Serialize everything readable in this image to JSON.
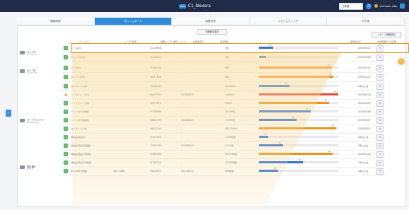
{
  "header": {
    "badge": "IIIIII",
    "title": "C1_Nexera",
    "language": "日本語",
    "help_icon": "?",
    "user": "shimadzu labo"
  },
  "tabs": [
    {
      "label": "機器稼働",
      "active": false
    },
    {
      "label": "ダッシュボード",
      "active": true
    },
    {
      "label": "装置状態",
      "active": false
    },
    {
      "label": "システムチェック",
      "active": false
    },
    {
      "label": "その他",
      "active": false
    }
  ],
  "toolbar": {
    "top_button": "全機器を表示",
    "right_button": "レポート機能追加"
  },
  "columns": {
    "col1": "ステータス",
    "col2": "シリアル番号",
    "col3": "機器シリアル番号 シリーズ",
    "col4": "最終使用日",
    "col5": "使用時間",
    "col6": "前回交換日",
    "col7": "交換予定日",
    "col8": "交換時期までの日数"
  },
  "groups": [
    {
      "name": "ポンプA",
      "sub": "LC-40D XR",
      "icon": "pump-icon"
    },
    {
      "name": "ポンプB",
      "sub": "LC-40D XR",
      "icon": "pump-icon"
    },
    {
      "name": "オートサンプラー",
      "sub": "SIL-40C XR",
      "icon": "autosampler-icon"
    },
    {
      "name": "検出器A",
      "sub": "SPD-40",
      "icon": "detector-icon"
    }
  ],
  "rows": [
    {
      "status": "ok",
      "name": "シール(A)",
      "serial": "",
      "code": "10130506",
      "last": "-",
      "hours": "5回",
      "pct": 0.18,
      "bar_color": "#2f6fd6",
      "bar_label": "18",
      "date": "2019/03/15"
    },
    {
      "status": "ok",
      "name": "チェック弁(A)",
      "serial": "",
      "code": "1219A6C0",
      "last": "-",
      "hours": "5回",
      "pct": 0.09,
      "bar_color": "#2f6fd6",
      "bar_label": "9",
      "date": "2019/05/18"
    },
    {
      "status": "ok",
      "name": "シール(B)",
      "serial": "",
      "code": "3A7B4340",
      "last": "-",
      "hours": "8回",
      "pct": 0.92,
      "bar_color": "#e8931c",
      "bar_label": "92",
      "date": "2019/01/31"
    },
    {
      "status": "ok",
      "name": "チェック弁(B)",
      "serial": "",
      "code": "3B5F1B90",
      "last": "-",
      "hours": "8回",
      "pct": 0.94,
      "bar_color": "#e8931c",
      "bar_label": "94",
      "date": "2019/02/27"
    },
    {
      "status": "ok",
      "name": "ロータシール(A)",
      "serial": "",
      "code": "7D4A57B0",
      "last": "-",
      "hours": "35,818mL",
      "pct": 0.38,
      "bar_color": "#2f6fd6",
      "bar_label": "38",
      "date": "1年以上先"
    },
    {
      "status": "warn",
      "name": "ニードルシール(A)",
      "serial": "",
      "code": "8A47F7D0",
      "last": "2018/08/23",
      "hours": "1,234mL",
      "pct": 1.0,
      "bar_color": "#e04b3c",
      "bar_label": "100",
      "date": "2019/01/18"
    },
    {
      "status": "ok",
      "name": "ニードルシール(B)",
      "serial": "",
      "code": "9A2F7A10",
      "last": "-",
      "hours": "944mL",
      "pct": 0.88,
      "bar_color": "#e8931c",
      "bar_label": "88",
      "date": "2019/04/05"
    },
    {
      "status": "ok",
      "name": "ニードル(A)[本数]",
      "serial": "",
      "code": "B73E8B80",
      "last": "-",
      "hours": "35,928回",
      "pct": 0.65,
      "bar_color": "#2f6fd6",
      "bar_label": "65",
      "date": "2019/02/04"
    },
    {
      "status": "ok",
      "name": "ニードル(B)[本数]",
      "serial": "",
      "code": "A4B8C7E0",
      "last": "2018/08/23",
      "hours": "29,456回",
      "pct": 0.47,
      "bar_color": "#2f6fd6",
      "bar_label": "47",
      "date": "2019/06/07"
    },
    {
      "status": "ok",
      "name": "ロータシール(B)",
      "serial": "",
      "code": "A8D12F40",
      "last": "-",
      "hours": "387,084mL",
      "pct": 0.97,
      "bar_color": "#e8931c",
      "bar_label": "97",
      "date": "2019/03/11"
    },
    {
      "status": "ok",
      "name": "消耗品(部品A)",
      "serial": "",
      "code": "4C9E1B20",
      "last": "-",
      "hours": "4,563時間",
      "pct": 0.12,
      "bar_color": "#2f6fd6",
      "bar_label": "12",
      "date": "1年以上先"
    },
    {
      "status": "ok",
      "name": "消耗品(部品B)[回数]",
      "serial": "",
      "code": "72A5C3E0",
      "last": "2018/08/23",
      "hours": "3,412回",
      "pct": 0.3,
      "bar_color": "#2f6fd6",
      "bar_label": "30",
      "date": "1年以上先"
    },
    {
      "status": "ok",
      "name": "消耗品(部品C)[本数]",
      "serial": "",
      "code": "5E8D2A90",
      "last": "-",
      "hours": "98,678時間",
      "pct": 0.93,
      "bar_color": "#e8931c",
      "bar_label": "93",
      "date": "2019/05/14"
    },
    {
      "status": "ok",
      "name": "消耗品(部品D)[時間]",
      "serial": "",
      "code": "6F3B7C10",
      "last": "-",
      "hours": "37,358時間",
      "pct": 0.55,
      "bar_color": "#2f6fd6",
      "bar_label": "55",
      "date": "1年以上先"
    },
    {
      "status": "ok",
      "name": "D2 LAMP (時間)",
      "serial": "ZB5-74887",
      "code": "9B4C8E70",
      "last": "2017/02/14",
      "hours": "649時間",
      "pct": 0.24,
      "bar_color": "#2f6fd6",
      "bar_label": "24",
      "date": "1年以上先"
    }
  ],
  "row_button_label": "≡"
}
